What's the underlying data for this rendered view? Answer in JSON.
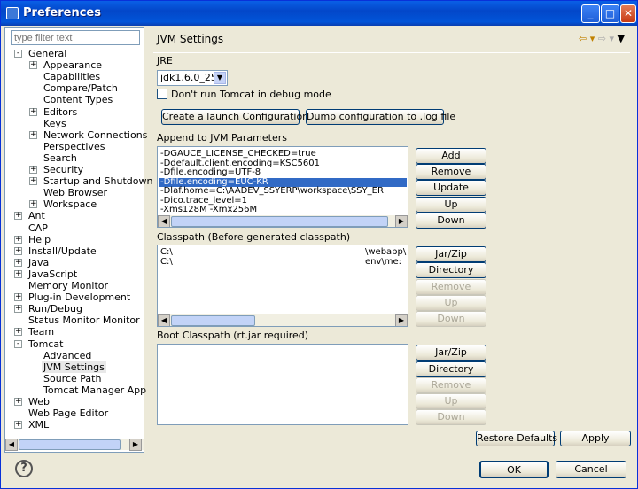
{
  "window": {
    "title": "Preferences"
  },
  "filter": {
    "placeholder": "type filter text"
  },
  "tree": [
    {
      "label": "General",
      "level": 0,
      "exp": "-"
    },
    {
      "label": "Appearance",
      "level": 1,
      "exp": "+"
    },
    {
      "label": "Capabilities",
      "level": 1,
      "exp": ""
    },
    {
      "label": "Compare/Patch",
      "level": 1,
      "exp": ""
    },
    {
      "label": "Content Types",
      "level": 1,
      "exp": ""
    },
    {
      "label": "Editors",
      "level": 1,
      "exp": "+"
    },
    {
      "label": "Keys",
      "level": 1,
      "exp": ""
    },
    {
      "label": "Network Connections",
      "level": 1,
      "exp": "+"
    },
    {
      "label": "Perspectives",
      "level": 1,
      "exp": ""
    },
    {
      "label": "Search",
      "level": 1,
      "exp": ""
    },
    {
      "label": "Security",
      "level": 1,
      "exp": "+"
    },
    {
      "label": "Startup and Shutdown",
      "level": 1,
      "exp": "+"
    },
    {
      "label": "Web Browser",
      "level": 1,
      "exp": ""
    },
    {
      "label": "Workspace",
      "level": 1,
      "exp": "+"
    },
    {
      "label": "Ant",
      "level": 0,
      "exp": "+"
    },
    {
      "label": "CAP",
      "level": 0,
      "exp": ""
    },
    {
      "label": "Help",
      "level": 0,
      "exp": "+"
    },
    {
      "label": "Install/Update",
      "level": 0,
      "exp": "+"
    },
    {
      "label": "Java",
      "level": 0,
      "exp": "+"
    },
    {
      "label": "JavaScript",
      "level": 0,
      "exp": "+"
    },
    {
      "label": "Memory Monitor",
      "level": 0,
      "exp": ""
    },
    {
      "label": "Plug-in Development",
      "level": 0,
      "exp": "+"
    },
    {
      "label": "Run/Debug",
      "level": 0,
      "exp": "+"
    },
    {
      "label": "Status Monitor Monitor",
      "level": 0,
      "exp": ""
    },
    {
      "label": "Team",
      "level": 0,
      "exp": "+"
    },
    {
      "label": "Tomcat",
      "level": 0,
      "exp": "-"
    },
    {
      "label": "Advanced",
      "level": 1,
      "exp": ""
    },
    {
      "label": "JVM Settings",
      "level": 1,
      "exp": "",
      "selected": true
    },
    {
      "label": "Source Path",
      "level": 1,
      "exp": ""
    },
    {
      "label": "Tomcat Manager App",
      "level": 1,
      "exp": ""
    },
    {
      "label": "Web",
      "level": 0,
      "exp": "+"
    },
    {
      "label": "Web Page Editor",
      "level": 0,
      "exp": ""
    },
    {
      "label": "XML",
      "level": 0,
      "exp": "+"
    }
  ],
  "page": {
    "title": "JVM Settings",
    "jre_label": "JRE",
    "jre_value": "jdk1.6.0_25",
    "debug_checkbox": "Don't run Tomcat in debug mode",
    "launch_button": "Create a launch Configuration",
    "dump_button": "Dump configuration to .log file",
    "append_label": "Append to JVM Parameters",
    "params": [
      "-DGAUCE_LICENSE_CHECKED=true",
      "-Ddefault.client.encoding=KSC5601",
      "-Dfile.encoding=UTF-8",
      "-Dfile.encoding=EUC-KR",
      "-Dlaf.home=C:\\AADEV_SSYERP\\workspace\\SSY_ER",
      "-Dico.trace_level=1",
      "-Xms128M -Xmx256M"
    ],
    "param_buttons": {
      "add": "Add",
      "remove": "Remove",
      "update": "Update",
      "up": "Up",
      "down": "Down"
    },
    "classpath_label": "Classpath (Before generated classpath)",
    "classpath": [
      {
        "left": "C:\\",
        "right": "\\webapp\\"
      },
      {
        "left": "C:\\",
        "right": "env\\me:"
      }
    ],
    "cp_buttons": {
      "jar": "Jar/Zip",
      "dir": "Directory",
      "remove": "Remove",
      "up": "Up",
      "down": "Down"
    },
    "boot_label": "Boot Classpath (rt.jar required)",
    "boot_buttons": {
      "jar": "Jar/Zip",
      "dir": "Directory",
      "remove": "Remove",
      "up": "Up",
      "down": "Down"
    },
    "restore_button": "Restore Defaults",
    "apply_button": "Apply"
  },
  "footer": {
    "ok": "OK",
    "cancel": "Cancel",
    "help_icon": "?"
  }
}
